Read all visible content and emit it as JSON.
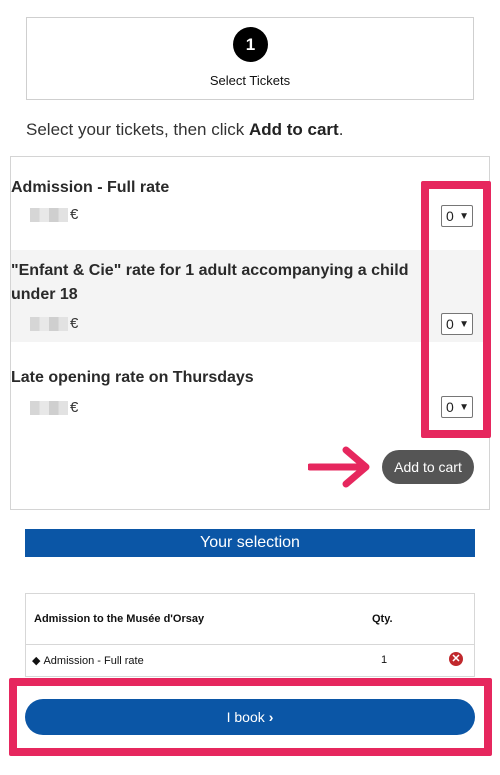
{
  "step": {
    "number": "1",
    "label": "Select Tickets"
  },
  "instruction": {
    "before": "Select your tickets, then click ",
    "bold": "Add to cart",
    "after": "."
  },
  "tickets": [
    {
      "name": "Admission - Full rate",
      "currency": "€",
      "qty": "0"
    },
    {
      "name_line1": "\"Enfant & Cie\" rate for 1 adult accompanying a child",
      "name_line2": "under 18",
      "currency": "€",
      "qty": "0"
    },
    {
      "name": "Late opening rate on Thursdays",
      "currency": "€",
      "qty": "0"
    }
  ],
  "add_to_cart_label": "Add to cart",
  "selection": {
    "heading": "Your selection",
    "col_item": "Admission to the Musée d'Orsay",
    "col_qty": "Qty.",
    "rows": [
      {
        "item": "Admission - Full rate",
        "qty": "1"
      }
    ]
  },
  "book_label": "I book",
  "colors": {
    "highlight": "#e6275e",
    "brand_blue": "#0b56a6",
    "cart_button": "#555555",
    "remove": "#c0282d"
  }
}
